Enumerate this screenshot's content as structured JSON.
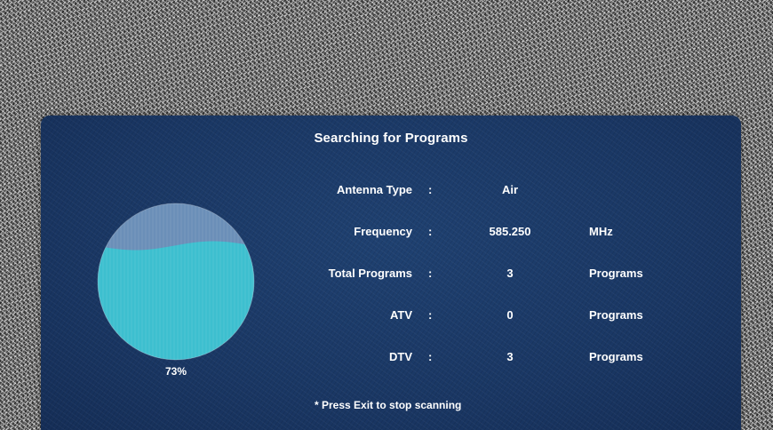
{
  "dialog": {
    "title": "Searching for Programs",
    "hint": "* Press Exit to stop scanning"
  },
  "progress": {
    "percent_label": "73%",
    "value": 0.73,
    "fill_color": "#3dbfcf",
    "empty_color": "#6b8fb8"
  },
  "rows": [
    {
      "label": "Antenna Type",
      "separator": ":",
      "value": "Air",
      "unit": ""
    },
    {
      "label": "Frequency",
      "separator": ":",
      "value": "585.250",
      "unit": "MHz"
    },
    {
      "label": "Total Programs",
      "separator": ":",
      "value": "3",
      "unit": "Programs"
    },
    {
      "label": "ATV",
      "separator": ":",
      "value": "0",
      "unit": "Programs"
    },
    {
      "label": "DTV",
      "separator": ":",
      "value": "3",
      "unit": "Programs"
    }
  ],
  "colors": {
    "panel": "#1d3b6a",
    "text": "#ffffff"
  }
}
